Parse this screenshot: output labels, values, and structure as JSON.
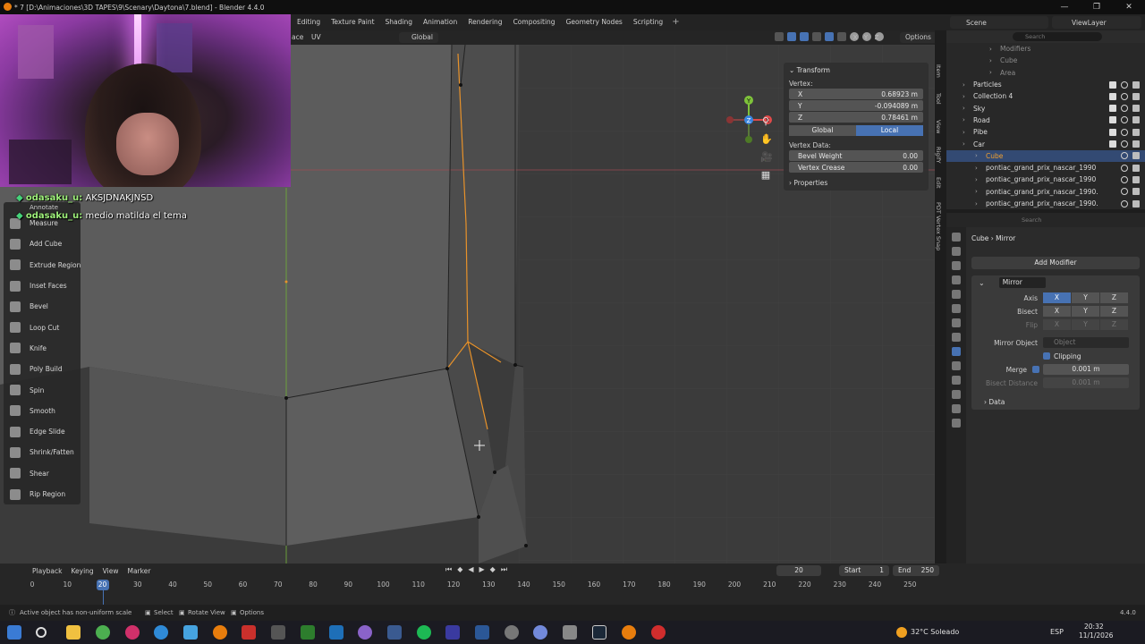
{
  "window": {
    "title": "* 7 [D:\\Animaciones\\3D TAPES\\9\\Scenary\\Daytona\\7.blend] - Blender 4.4.0",
    "controls": [
      "—",
      "❐",
      "✕"
    ]
  },
  "workspaces": [
    "Editing",
    "Texture Paint",
    "Shading",
    "Animation",
    "Rendering",
    "Compositing",
    "Geometry Nodes",
    "Scripting"
  ],
  "workspace_add": "+",
  "scene": {
    "name": "Scene",
    "view_layer": "ViewLayer"
  },
  "viewport_header": {
    "face_label": "ace",
    "uv_menu": "UV",
    "orientation": "Global",
    "options": "Options",
    "axes": [
      "X",
      "Y",
      "Z"
    ]
  },
  "chat": [
    {
      "user": "odasaku_u:",
      "message": "AKSJDNAKJNSD"
    },
    {
      "user": "odasaku_u:",
      "message": "medio matilda el tema"
    }
  ],
  "toolbar": {
    "annotate": "Annotate",
    "tools": [
      "Measure",
      "Add Cube",
      "Extrude Region",
      "Inset Faces",
      "Bevel",
      "Loop Cut",
      "Knife",
      "Poly Build",
      "Spin",
      "Smooth",
      "Edge Slide",
      "Shrink/Fatten",
      "Shear",
      "Rip Region"
    ]
  },
  "gizmo": {
    "x": "X",
    "y": "Y",
    "z": "Z"
  },
  "nav_icons": [
    "⚲",
    "✋",
    "🎥",
    "▦"
  ],
  "npanel": {
    "header": "Transform",
    "vertex_label": "Vertex:",
    "vx_label": "X",
    "vx": "0.68923 m",
    "vy_label": "Y",
    "vy": "-0.094089 m",
    "vz_label": "Z",
    "vz": "0.78461 m",
    "global": "Global",
    "local": "Local",
    "vertex_data": "Vertex Data:",
    "bevel_weight_label": "Bevel Weight",
    "bevel_weight": "0.00",
    "vertex_crease_label": "Vertex Crease",
    "vertex_crease": "0.00",
    "properties": "Properties"
  },
  "side_tabs": [
    "Item",
    "Tool",
    "View",
    "RigifY",
    "Edit",
    "PDT Vertex Snap"
  ],
  "outliner": {
    "search_placeholder": "Search",
    "rows": [
      {
        "label": "Modifiers",
        "indent": 60,
        "dim": true
      },
      {
        "label": "Cube",
        "indent": 60,
        "dim": true
      },
      {
        "label": "Area",
        "indent": 60,
        "dim": true
      },
      {
        "label": "Particles",
        "indent": 30
      },
      {
        "label": "Collection 4",
        "indent": 30
      },
      {
        "label": "Sky",
        "indent": 30
      },
      {
        "label": "Road",
        "indent": 30
      },
      {
        "label": "Pibe",
        "indent": 30
      },
      {
        "label": "Car",
        "indent": 30
      },
      {
        "label": "Cube",
        "indent": 44,
        "selected": true
      },
      {
        "label": "pontiac_grand_prix_nascar_1990",
        "indent": 44
      },
      {
        "label": "pontiac_grand_prix_nascar_1990",
        "indent": 44
      },
      {
        "label": "pontiac_grand_prix_nascar_1990.",
        "indent": 44
      },
      {
        "label": "pontiac_grand_prix_nascar_1990.",
        "indent": 44
      }
    ]
  },
  "properties": {
    "search_placeholder": "Search",
    "object": "Cube",
    "modifier_crumb": "Mirror",
    "add_modifier": "Add Modifier",
    "modifier_name": "Mirror",
    "axis_label": "Axis",
    "bisect_label": "Bisect",
    "flip_label": "Flip",
    "mirror_object_label": "Mirror Object",
    "mirror_object_placeholder": "Object",
    "clipping_label": "Clipping",
    "merge_label": "Merge",
    "merge_value": "0.001 m",
    "bisect_distance_label": "Bisect Distance",
    "bisect_distance_value": "0.001 m",
    "data_label": "Data",
    "xyz": [
      "X",
      "Y",
      "Z"
    ]
  },
  "timeline": {
    "menus": [
      "Playback",
      "Keying",
      "View",
      "Marker"
    ],
    "current_frame": "20",
    "start_label": "Start",
    "start": "1",
    "end_label": "End",
    "end": "250",
    "ruler": [
      "0",
      "10",
      "20",
      "30",
      "40",
      "50",
      "60",
      "70",
      "80",
      "90",
      "100",
      "110",
      "120",
      "130",
      "140",
      "150",
      "160",
      "170",
      "180",
      "190",
      "200",
      "210",
      "220",
      "230",
      "240",
      "250"
    ]
  },
  "statusbar": {
    "message": "Active object has non-uniform scale",
    "select": "Select",
    "rotate_view": "Rotate View",
    "options": "Options",
    "version": "4.4.0"
  },
  "taskbar": {
    "weather": "32°C  Soleado",
    "lang": "ESP",
    "time": "20:32",
    "date": "11/1/2026"
  },
  "colors": {
    "accent": "#4772b3",
    "viewport_bg": "#3a3a3a",
    "selected_edge": "#e8922a",
    "x_axis": "#e04a4a",
    "y_axis": "#7ec23a",
    "z_axis": "#3a86e0"
  }
}
